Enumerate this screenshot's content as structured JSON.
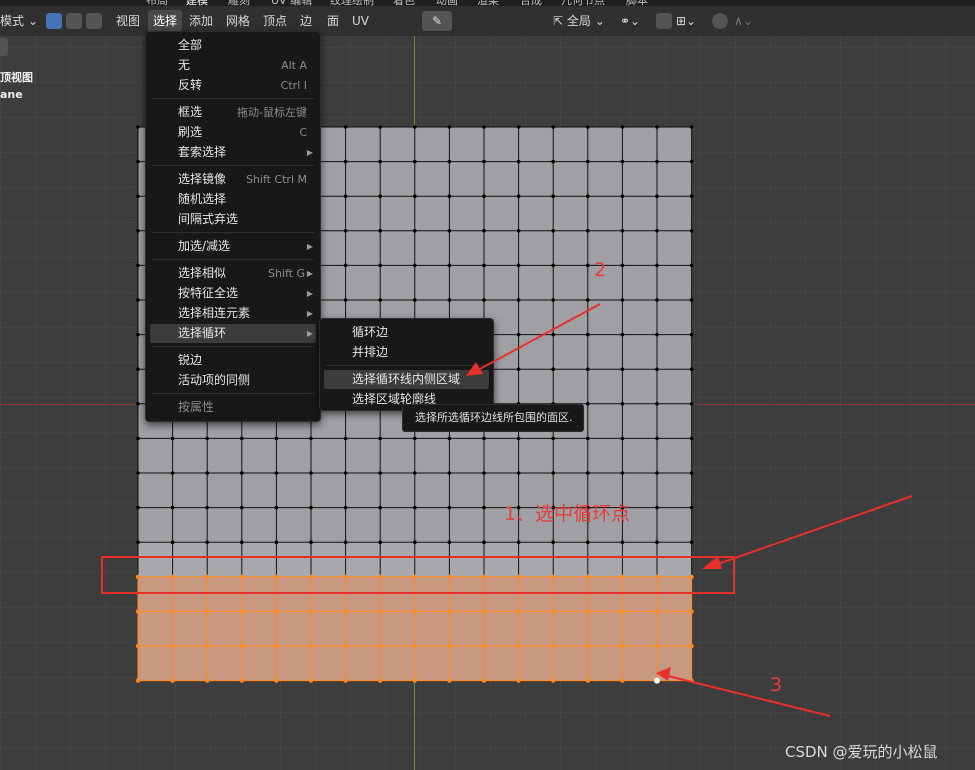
{
  "workspace_tabs": [
    {
      "label": "布局",
      "active": false
    },
    {
      "label": "建模",
      "active": true
    },
    {
      "label": "雕刻",
      "active": false
    },
    {
      "label": "UV 编辑",
      "active": false
    },
    {
      "label": "纹理绘制",
      "active": false
    },
    {
      "label": "着色",
      "active": false
    },
    {
      "label": "动画",
      "active": false
    },
    {
      "label": "渲染",
      "active": false
    },
    {
      "label": "合成",
      "active": false
    },
    {
      "label": "几何节点",
      "active": false
    },
    {
      "label": "脚本",
      "active": false
    }
  ],
  "header": {
    "mode": "模式",
    "menus": [
      "视图",
      "选择",
      "添加",
      "网格",
      "顶点",
      "边",
      "面",
      "UV"
    ],
    "active_menu": "选择",
    "transform_orientation": "全局",
    "select_mode_icons": [
      "vertex-select-icon",
      "edge-select-icon",
      "face-select-icon"
    ],
    "eyedropper_icon": "eyedropper-icon",
    "snap_icon": "snap-icon",
    "proportional_icon": "proportional-edit-icon"
  },
  "viewport_info": {
    "view_name": "顶视图",
    "object_name": "ane"
  },
  "select_menu": {
    "items": [
      {
        "label": "全部",
        "shortcut": ""
      },
      {
        "label": "无",
        "shortcut": "Alt A"
      },
      {
        "label": "反转",
        "shortcut": "Ctrl I"
      },
      {
        "label": "框选",
        "shortcut": "拖动-鼠标左键"
      },
      {
        "label": "刷选",
        "shortcut": "C"
      },
      {
        "label": "套索选择",
        "submenu": true
      },
      {
        "label": "选择镜像",
        "shortcut": "Shift Ctrl M"
      },
      {
        "label": "随机选择",
        "shortcut": ""
      },
      {
        "label": "间隔式弃选",
        "shortcut": ""
      },
      {
        "label": "加选/减选",
        "submenu": true
      },
      {
        "label": "选择相似",
        "shortcut": "Shift G",
        "submenu": true
      },
      {
        "label": "按特征全选",
        "submenu": true
      },
      {
        "label": "选择相连元素",
        "submenu": true
      },
      {
        "label": "选择循环",
        "submenu": true,
        "highlighted": true
      },
      {
        "label": "锐边",
        "shortcut": ""
      },
      {
        "label": "活动项的同侧",
        "shortcut": ""
      },
      {
        "label": "按属性",
        "shortcut": "",
        "disabled": true
      }
    ]
  },
  "loop_submenu": {
    "items": [
      {
        "label": "循环边"
      },
      {
        "label": "并排边"
      },
      {
        "label": "选择循环线内侧区域",
        "highlighted": true
      },
      {
        "label": "选择区域轮廓线"
      }
    ]
  },
  "tooltip": "选择所选循环边线所包围的面区.",
  "annotations": {
    "step1": "1、选中循环点",
    "step2": "2",
    "step3": "3",
    "accent_color": "#e83b3b"
  },
  "colors": {
    "selected_face": "#c89880",
    "selected_edge": "#ff8a1e",
    "mesh_face": "#a0a0a4",
    "header_bg": "#303030",
    "menu_bg": "#181818"
  },
  "watermark": "CSDN @爱玩的小松鼠"
}
